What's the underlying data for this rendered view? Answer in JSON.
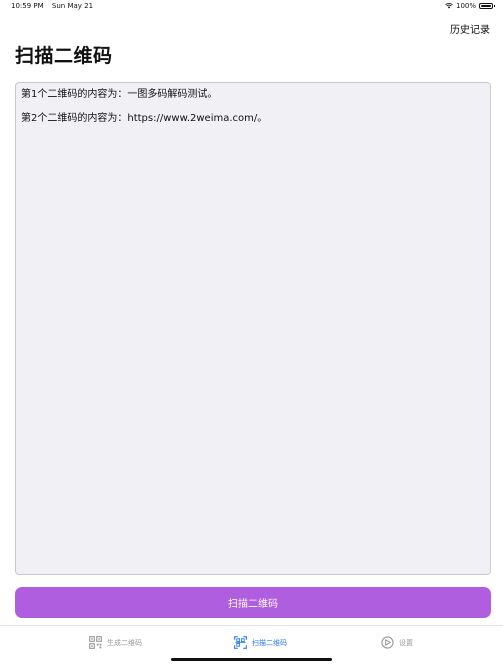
{
  "status_bar": {
    "time": "10:59 PM",
    "date": "Sun May 21",
    "battery": "100%"
  },
  "nav": {
    "history_label": "历史记录",
    "title": "扫描二维码"
  },
  "results": [
    "第1个二维码的内容为：一图多码解码测试。",
    "第2个二维码的内容为：https://www.2weima.com/。"
  ],
  "scan_button": {
    "label": "扫描二维码",
    "color": "#b05ee0"
  },
  "tab_bar": {
    "tabs": [
      {
        "label": "生成二维码",
        "icon": "qr-code-icon",
        "active": false
      },
      {
        "label": "扫描二维码",
        "icon": "scan-qr-icon",
        "active": true
      },
      {
        "label": "设置",
        "icon": "settings-icon",
        "active": false
      }
    ],
    "active_color": "#2f7df6",
    "inactive_color": "#9a9a9a"
  }
}
